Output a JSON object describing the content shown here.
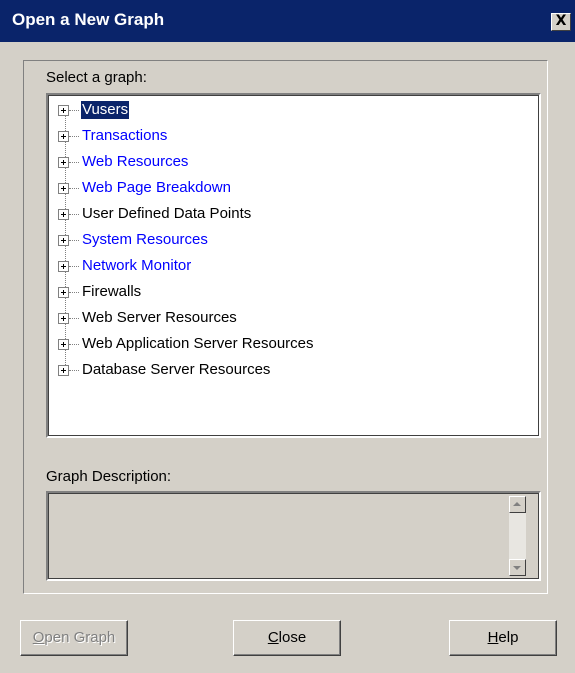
{
  "window": {
    "title": "Open a New Graph",
    "close_glyph": "X",
    "titlebar_color": "#0a246a",
    "background_color": "#d4d0c8"
  },
  "select_label": "Select a graph:",
  "tree": {
    "items": [
      {
        "label": "Vusers",
        "style": "selected"
      },
      {
        "label": "Transactions",
        "style": "link"
      },
      {
        "label": "Web Resources",
        "style": "link"
      },
      {
        "label": "Web Page Breakdown",
        "style": "link"
      },
      {
        "label": "User Defined Data Points",
        "style": "normal"
      },
      {
        "label": "System Resources",
        "style": "link"
      },
      {
        "label": "Network Monitor",
        "style": "link"
      },
      {
        "label": "Firewalls",
        "style": "normal"
      },
      {
        "label": "Web Server Resources",
        "style": "normal"
      },
      {
        "label": "Web Application Server Resources",
        "style": "normal"
      },
      {
        "label": "Database Server Resources",
        "style": "normal"
      }
    ],
    "link_color": "#0000ff",
    "expander_icon": "plus-box-icon"
  },
  "description_label": "Graph Description:",
  "buttons": {
    "open_graph": {
      "label_first": "O",
      "label_rest": "pen Graph",
      "enabled": false
    },
    "close": {
      "label_first": "C",
      "label_rest": "lose",
      "enabled": true
    },
    "help": {
      "label_first": "H",
      "label_rest": "elp",
      "enabled": true
    }
  }
}
